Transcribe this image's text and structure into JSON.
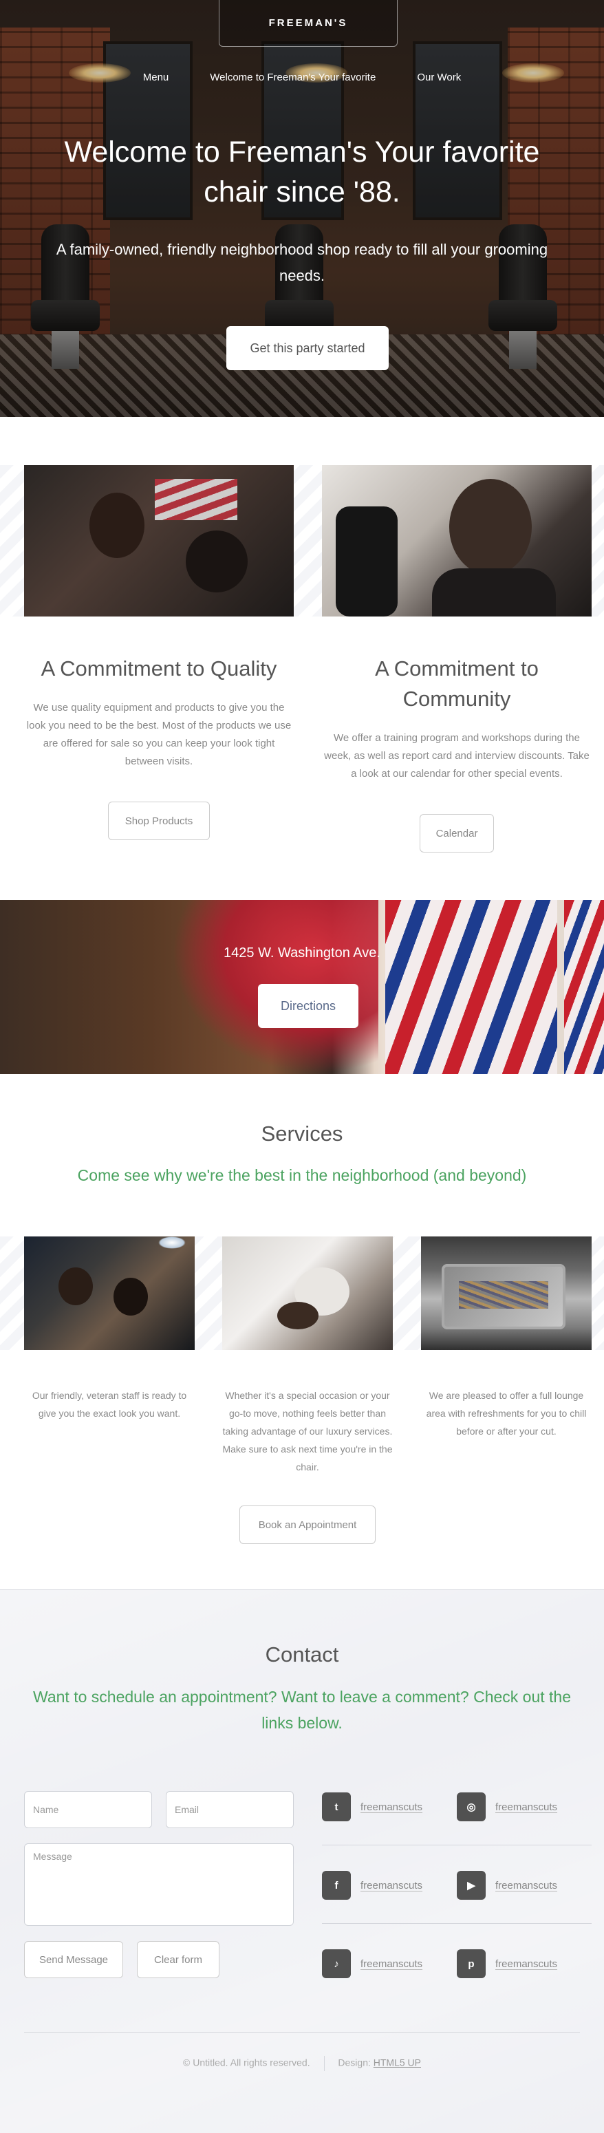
{
  "header": {
    "brand": "FREEMAN'S",
    "nav": [
      "Menu",
      "Welcome to Freeman's Your favorite",
      "Our Work"
    ]
  },
  "hero": {
    "title": "Welcome to Freeman's Your favorite chair since '88.",
    "subtitle": "A family-owned, friendly neighborhood shop ready to fill all your grooming needs.",
    "cta": "Get this party started"
  },
  "features": [
    {
      "title": "A Commitment to Quality",
      "text": "We use quality equipment and products to give you the look you need to be the best. Most of the products we use are offered for sale so you can keep your look tight between visits.",
      "button": "Shop Products"
    },
    {
      "title": "A Commitment to Community",
      "text": "We offer a training program and workshops during the week, as well as report card and interview discounts. Take a look at our calendar for other special events.",
      "button": "Calendar"
    }
  ],
  "banner": {
    "address": "1425 W. Washington Ave.",
    "button": "Directions"
  },
  "services": {
    "title": "Services",
    "subtitle": "Come see why we're the best in the neighborhood (and beyond)",
    "items": [
      "Our friendly, veteran staff is ready to give you the exact look you want.",
      "Whether it's a special occasion or your go-to move, nothing feels better than taking advantage of our luxury services. Make sure to ask next time you're in the chair.",
      "We are pleased to offer a full lounge area with refreshments for you to chill before or after your cut."
    ],
    "button": "Book an Appointment"
  },
  "contact": {
    "title": "Contact",
    "subtitle": "Want to schedule an appointment? Want to leave a comment? Check out the links below.",
    "form": {
      "name_placeholder": "Name",
      "email_placeholder": "Email",
      "message_placeholder": "Message",
      "send": "Send Message",
      "clear": "Clear form"
    },
    "socials": [
      {
        "icon": "twitter-icon",
        "glyph": "t",
        "handle": "freemanscuts"
      },
      {
        "icon": "instagram-icon",
        "glyph": "◎",
        "handle": "freemanscuts"
      },
      {
        "icon": "facebook-icon",
        "glyph": "f",
        "handle": "freemanscuts"
      },
      {
        "icon": "youtube-icon",
        "glyph": "▶",
        "handle": "freemanscuts"
      },
      {
        "icon": "tiktok-icon",
        "glyph": "♪",
        "handle": "freemanscuts"
      },
      {
        "icon": "pinterest-icon",
        "glyph": "p",
        "handle": "freemanscuts"
      }
    ]
  },
  "footer": {
    "copyright": "© Untitled. All rights reserved.",
    "design_label": "Design:",
    "design_link": "HTML5 UP"
  },
  "colors": {
    "accent_green": "#4ba360",
    "icon_bg": "#515151",
    "contact_bg": "#eff0f4"
  }
}
